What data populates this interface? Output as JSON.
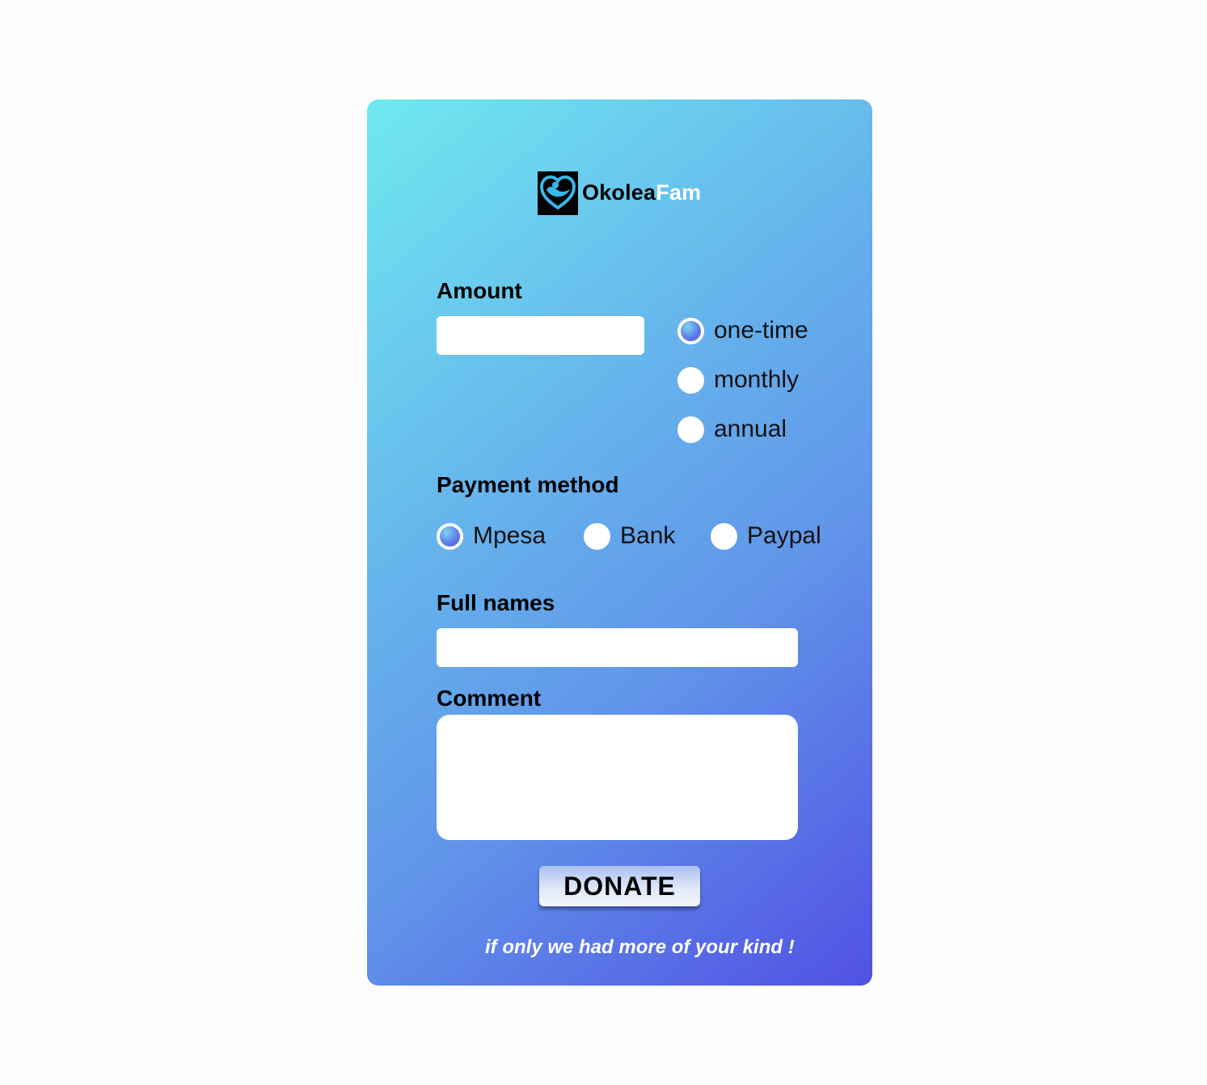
{
  "brand": {
    "name_part1": "Okolea",
    "name_part2": "Fam",
    "logo_icon": "heart-hands-icon"
  },
  "amount": {
    "label": "Amount",
    "value": "",
    "frequency_options": [
      {
        "label": "one-time",
        "checked": true
      },
      {
        "label": "monthly",
        "checked": false
      },
      {
        "label": "annual",
        "checked": false
      }
    ]
  },
  "payment": {
    "label": "Payment method",
    "options": [
      {
        "label": "Mpesa",
        "checked": true
      },
      {
        "label": "Bank",
        "checked": false
      },
      {
        "label": "Paypal",
        "checked": false
      }
    ]
  },
  "full_names": {
    "label": "Full names",
    "value": ""
  },
  "comment": {
    "label": "Comment",
    "value": ""
  },
  "donate_button": {
    "label": "DONATE"
  },
  "tagline": "if only we had more of your kind !",
  "colors": {
    "gradient_start": "#6fe9ef",
    "gradient_end": "#5151e4",
    "brand_accent": "#ffffff"
  }
}
